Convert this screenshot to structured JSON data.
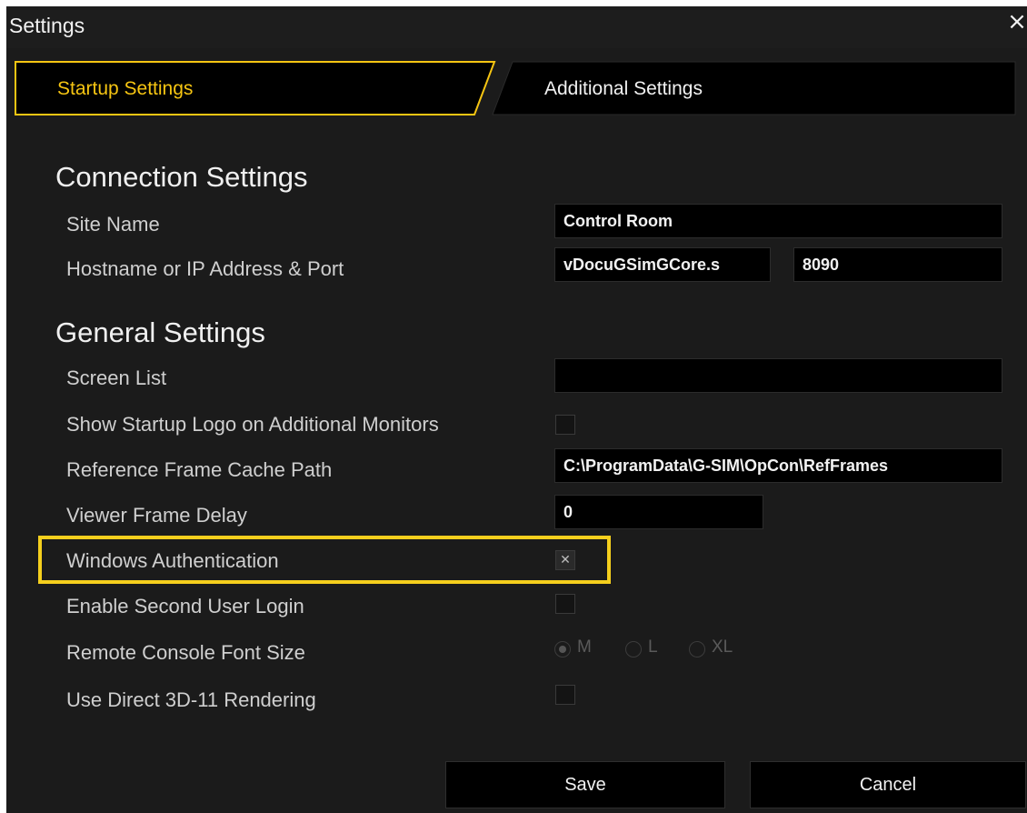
{
  "window": {
    "title": "Settings",
    "close_glyph": "×"
  },
  "tabs": [
    {
      "label": "Startup Settings",
      "active": true
    },
    {
      "label": "Additional Settings",
      "active": false
    }
  ],
  "connection": {
    "heading": "Connection Settings",
    "site_name": {
      "label": "Site Name",
      "value": "Control Room"
    },
    "host": {
      "label": "Hostname or IP Address & Port",
      "value": "vDocuGSimGCore.s",
      "port": "8090"
    }
  },
  "general": {
    "heading": "General Settings",
    "screen_list": {
      "label": "Screen List",
      "value": ""
    },
    "startup_logo": {
      "label": "Show Startup Logo on Additional Monitors",
      "checked": false
    },
    "cache_path": {
      "label": "Reference Frame Cache Path",
      "value": "C:\\ProgramData\\G-SIM\\OpCon\\RefFrames"
    },
    "frame_delay": {
      "label": "Viewer Frame Delay",
      "value": "0"
    },
    "windows_auth": {
      "label": "Windows Authentication",
      "checked": true,
      "mark": "✕"
    },
    "second_login": {
      "label": "Enable Second User Login",
      "checked": false
    },
    "font_size": {
      "label": "Remote Console Font Size",
      "options": [
        "M",
        "L",
        "XL"
      ],
      "selected": "M"
    },
    "direct3d": {
      "label": "Use Direct 3D-11 Rendering",
      "checked": false
    }
  },
  "buttons": {
    "save": "Save",
    "cancel": "Cancel"
  },
  "colors": {
    "accent": "#f6c512",
    "highlight": "#f5cf1d",
    "background": "#1b1b1b"
  },
  "icons": {
    "close": "close-icon",
    "check": "checkmark-icon"
  }
}
